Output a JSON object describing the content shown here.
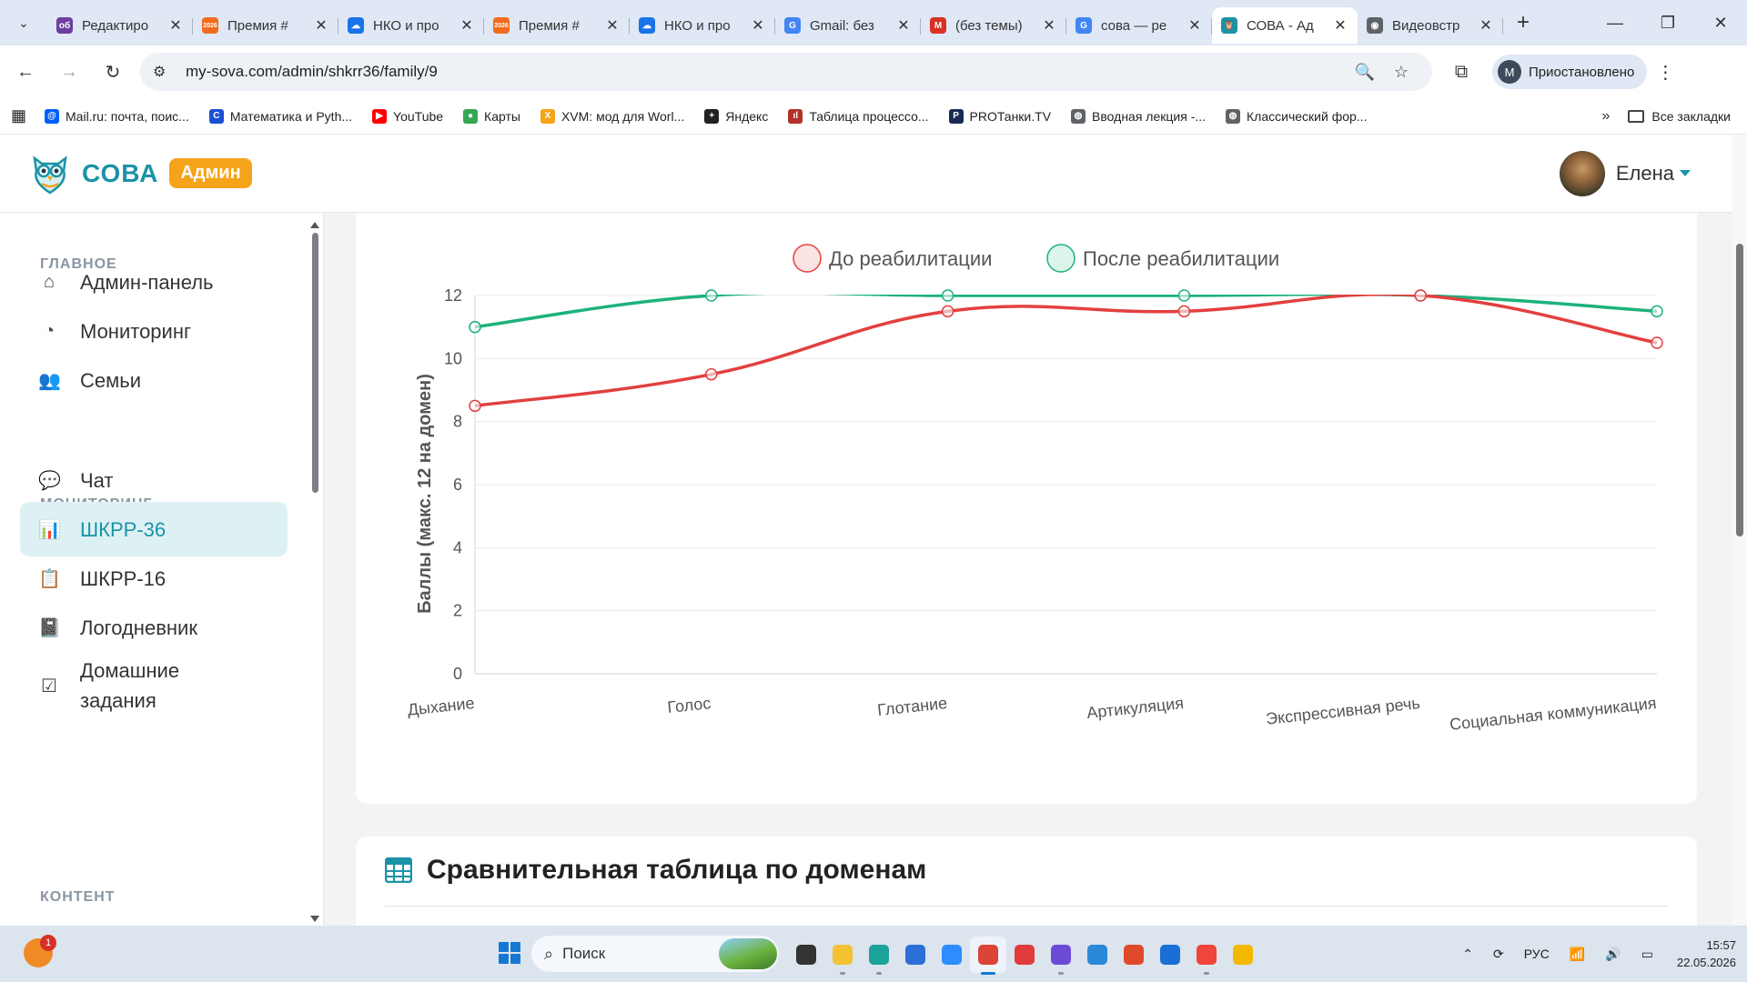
{
  "browser": {
    "tabs": [
      {
        "title": "Редактиро",
        "icon_color": "#6b3fa0",
        "icon_text": "об"
      },
      {
        "title": "Премия #",
        "icon_color": "#f26b1d",
        "icon_text": "2026"
      },
      {
        "title": "НКО и про",
        "icon_color": "#1a73e8",
        "icon_text": "☁"
      },
      {
        "title": "Премия #",
        "icon_color": "#f26b1d",
        "icon_text": "2026"
      },
      {
        "title": "НКО и про",
        "icon_color": "#1a73e8",
        "icon_text": "☁"
      },
      {
        "title": "Gmail: без",
        "icon_color": "#4285f4",
        "icon_text": "G"
      },
      {
        "title": "(без темы)",
        "icon_color": "#d93025",
        "icon_text": "M"
      },
      {
        "title": "сова — ре",
        "icon_color": "#4285f4",
        "icon_text": "G"
      },
      {
        "title": "СОВА - Ад",
        "icon_color": "#1a93a8",
        "icon_text": "🦉"
      },
      {
        "title": "Видеовстр",
        "icon_color": "#5f6368",
        "icon_text": "◉"
      }
    ],
    "active_tab_index": 8,
    "new_tab_label": "+",
    "url": "my-sova.com/admin/shkrr36/family/9",
    "profile_initial": "M",
    "profile_label": "Приостановлено",
    "bookmarks": [
      {
        "label": "Mail.ru: почта, поис...",
        "icon_color": "#005ff9",
        "icon_text": "@"
      },
      {
        "label": "Математика и Pyth...",
        "icon_color": "#1a4fd6",
        "icon_text": "C"
      },
      {
        "label": "YouTube",
        "icon_color": "#ff0000",
        "icon_text": "▶"
      },
      {
        "label": "Карты",
        "icon_color": "#34a853",
        "icon_text": "●"
      },
      {
        "label": "XVM: мод для Worl...",
        "icon_color": "#f5a31a",
        "icon_text": "X"
      },
      {
        "label": "Яндекс",
        "icon_color": "#222222",
        "icon_text": "+"
      },
      {
        "label": "Таблица процессо...",
        "icon_color": "#b0302a",
        "icon_text": "ıl"
      },
      {
        "label": "PROТанки.TV",
        "icon_color": "#1a2a55",
        "icon_text": "P"
      },
      {
        "label": "Вводная лекция -...",
        "icon_color": "#5f6368",
        "icon_text": "◍"
      },
      {
        "label": "Классический фор...",
        "icon_color": "#5f6368",
        "icon_text": "◍"
      }
    ],
    "bookmarks_more": "»",
    "all_bookmarks": "Все закладки"
  },
  "app": {
    "logo_text": "СОВА",
    "admin_badge": "Админ",
    "user_name": "Елена"
  },
  "sidebar": {
    "sections": [
      {
        "title": "ГЛАВНОЕ"
      },
      {
        "title": "МОНИТОРИНГ"
      },
      {
        "title": "КОНТЕНТ"
      }
    ],
    "items": [
      {
        "label": "Админ-панель",
        "icon": "home-icon",
        "glyph": "⌂"
      },
      {
        "label": "Мониторинг",
        "icon": "gauge-icon",
        "glyph": "◔"
      },
      {
        "label": "Семьи",
        "icon": "people-icon",
        "glyph": "👥"
      },
      {
        "label": "Чат",
        "icon": "chat-icon",
        "glyph": "💬"
      },
      {
        "label": "ШКРР-36",
        "icon": "chart-clipboard-icon",
        "glyph": "📊",
        "active": true
      },
      {
        "label": "ШКРР-16",
        "icon": "clipboard-check-icon",
        "glyph": "📋"
      },
      {
        "label": "Логодневник",
        "icon": "journal-icon",
        "glyph": "📓"
      },
      {
        "label": "Домашние задания",
        "icon": "task-check-icon",
        "glyph": "☑"
      }
    ]
  },
  "chart_data": {
    "type": "line",
    "categories": [
      "Дыхание",
      "Голос",
      "Глотание",
      "Артикуляция",
      "Экспрессивная речь",
      "Социальная коммуникация"
    ],
    "series": [
      {
        "name": "До реабилитации",
        "values": [
          8.5,
          9.5,
          11.5,
          11.5,
          12,
          10.5
        ],
        "color": "#e2403f"
      },
      {
        "name": "После реабилитации",
        "values": [
          11,
          12,
          12,
          12,
          12,
          11.5
        ],
        "color": "#1db27a"
      }
    ],
    "ylabel": "Баллы (макс. 12 на домен)",
    "ylim": [
      0,
      12
    ],
    "yticks": [
      0,
      2,
      4,
      6,
      8,
      10,
      12
    ],
    "grid": true,
    "legend": "top-center"
  },
  "table_section": {
    "title": "Сравнительная таблица по доменам"
  },
  "taskbar": {
    "notification_count": "1",
    "search_placeholder": "Поиск",
    "language": "РУС",
    "time": "15:57",
    "date": "22.05.2026"
  }
}
